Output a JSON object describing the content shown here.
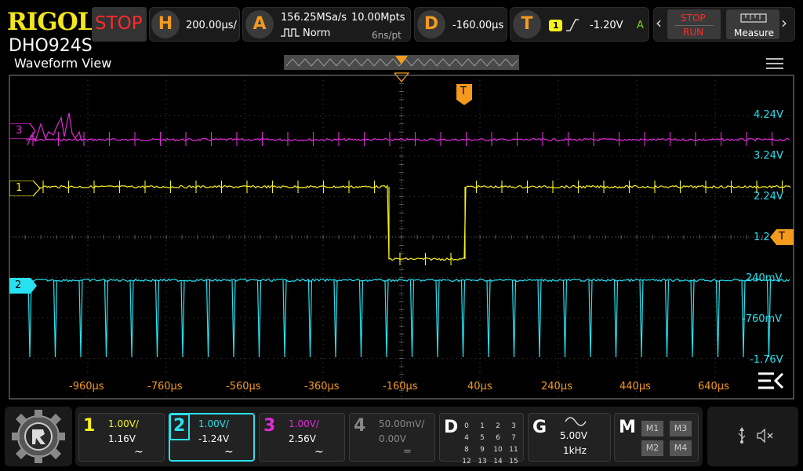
{
  "brand": {
    "logo": "RIGOL",
    "model": "DHO924S",
    "run_state": "STOP"
  },
  "header": {
    "h": {
      "letter": "H",
      "value": "200.00µs/"
    },
    "a": {
      "letter": "A",
      "rate": "156.25MSa/s",
      "mem": "10.00Mpts",
      "mode": "Norm",
      "period": "6ns/pt"
    },
    "d": {
      "letter": "D",
      "value": "-160.00µs"
    },
    "t": {
      "letter": "T",
      "channel": "1",
      "level": "-1.20V",
      "mode": "A"
    },
    "stop_run": {
      "stop": "STOP",
      "run": "RUN"
    },
    "measure": "Measure"
  },
  "view": {
    "title": "Waveform View"
  },
  "markers": {
    "ch3": "3",
    "ch1": "1",
    "ch2": "2",
    "trig": "T"
  },
  "right_scale": [
    "4.24V",
    "3.24V",
    "2.24V",
    "1.2",
    "240mV",
    "-760mV",
    "-1.76V"
  ],
  "time_labels": [
    "-960µs",
    "-760µs",
    "-560µs",
    "-360µs",
    "-160µs",
    "40µs",
    "240µs",
    "440µs",
    "640µs"
  ],
  "channels": [
    {
      "num": "1",
      "scale": "1.00V/",
      "offset": "1.16V",
      "coupling": "~",
      "color": "#f7f21b"
    },
    {
      "num": "2",
      "scale": "1.00V/",
      "offset": "-1.24V",
      "coupling": "~",
      "color": "#27e1f0"
    },
    {
      "num": "3",
      "scale": "1.00V/",
      "offset": "2.56V",
      "coupling": "~",
      "color": "#e02bd8"
    },
    {
      "num": "4",
      "scale": "50.00mV/",
      "offset": "0.00V",
      "coupling": "=",
      "color": "#888888"
    }
  ],
  "digital": {
    "letter": "D",
    "rows": [
      [
        "0",
        "1",
        "2",
        "3"
      ],
      [
        "4",
        "5",
        "6",
        "7"
      ],
      [
        "8",
        "9",
        "10",
        "11"
      ],
      [
        "12",
        "13",
        "14",
        "15"
      ]
    ]
  },
  "generator": {
    "letter": "G",
    "amp": "5.00V",
    "freq": "1kHz"
  },
  "math": {
    "letter": "M",
    "items": [
      "M1",
      "M3",
      "M2",
      "M4"
    ]
  },
  "colors": {
    "ch1": "#f7f21b",
    "ch2": "#27e1f0",
    "ch3": "#e02bd8",
    "trigger": "#f39a1f"
  }
}
